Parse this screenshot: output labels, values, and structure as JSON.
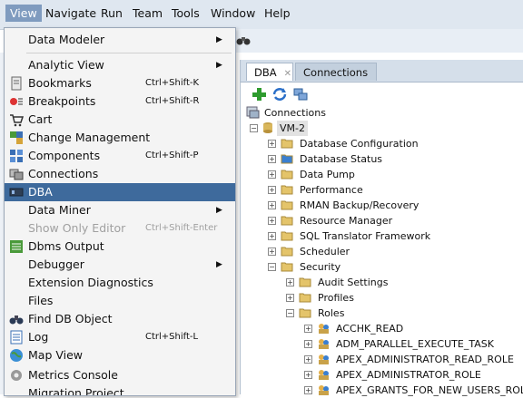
{
  "menubar": {
    "items": [
      "View",
      "Navigate",
      "Run",
      "Team",
      "Tools",
      "Window",
      "Help"
    ]
  },
  "tabs": {
    "dba": "DBA",
    "connections": "Connections"
  },
  "tree": {
    "root": "Connections",
    "connection": "VM-2",
    "nodes": [
      "Database Configuration",
      "Database Status",
      "Data Pump",
      "Performance",
      "RMAN Backup/Recovery",
      "Resource Manager",
      "SQL Translator Framework",
      "Scheduler",
      "Security"
    ],
    "security_children": [
      "Audit Settings",
      "Profiles",
      "Roles"
    ],
    "roles": [
      "ACCHK_READ",
      "ADM_PARALLEL_EXECUTE_TASK",
      "APEX_ADMINISTRATOR_READ_ROLE",
      "APEX_ADMINISTRATOR_ROLE",
      "APEX_GRANTS_FOR_NEW_USERS_ROLE"
    ]
  },
  "menu": {
    "items": [
      {
        "label": "Data Modeler",
        "shortcut": "",
        "submenu": true
      },
      {
        "label": "Analytic View",
        "shortcut": "",
        "submenu": true
      },
      {
        "label": "Bookmarks",
        "shortcut": "Ctrl+Shift-K",
        "submenu": false
      },
      {
        "label": "Breakpoints",
        "shortcut": "Ctrl+Shift-R",
        "submenu": false
      },
      {
        "label": "Cart",
        "shortcut": "",
        "submenu": false
      },
      {
        "label": "Change Management",
        "shortcut": "",
        "submenu": false
      },
      {
        "label": "Components",
        "shortcut": "Ctrl+Shift-P",
        "submenu": false
      },
      {
        "label": "Connections",
        "shortcut": "",
        "submenu": false
      },
      {
        "label": "DBA",
        "shortcut": "",
        "submenu": false,
        "selected": true
      },
      {
        "label": "Data Miner",
        "shortcut": "",
        "submenu": true
      },
      {
        "label": "Show Only Editor",
        "shortcut": "Ctrl+Shift-Enter",
        "submenu": false,
        "disabled": true
      },
      {
        "label": "Dbms Output",
        "shortcut": "",
        "submenu": false
      },
      {
        "label": "Debugger",
        "shortcut": "",
        "submenu": true
      },
      {
        "label": "Extension Diagnostics",
        "shortcut": "",
        "submenu": false
      },
      {
        "label": "Files",
        "shortcut": "",
        "submenu": false
      },
      {
        "label": "Find DB Object",
        "shortcut": "",
        "submenu": false
      },
      {
        "label": "Log",
        "shortcut": "Ctrl+Shift-L",
        "submenu": false
      },
      {
        "label": "Map View",
        "shortcut": "",
        "submenu": false
      },
      {
        "label": "Metrics Console",
        "shortcut": "",
        "submenu": false
      },
      {
        "label": "Migration Project",
        "shortcut": "",
        "submenu": false
      }
    ]
  },
  "colors": {
    "selection": "#3e6a9c",
    "menubar": "#dfe7f0"
  }
}
